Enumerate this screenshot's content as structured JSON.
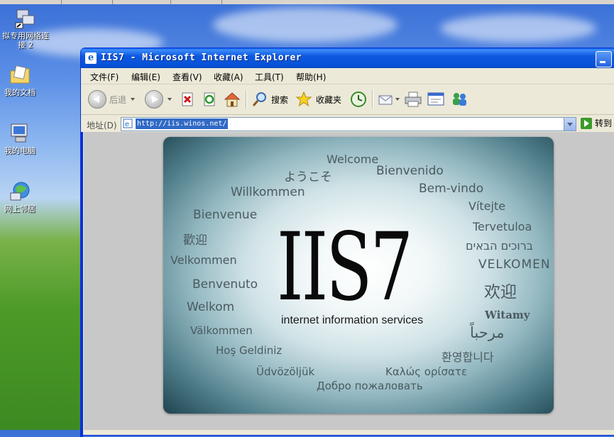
{
  "desktop": {
    "icons": [
      {
        "label": "拟专用网络连接 2",
        "icon": "network-connection-icon"
      },
      {
        "label": "我的文档",
        "icon": "my-documents-icon"
      },
      {
        "label": "我的电脑",
        "icon": "my-computer-icon"
      },
      {
        "label": "网上邻居",
        "icon": "network-places-icon"
      }
    ]
  },
  "window": {
    "title": "IIS7 - Microsoft Internet Explorer",
    "menu": [
      "文件(F)",
      "编辑(E)",
      "查看(V)",
      "收藏(A)",
      "工具(T)",
      "帮助(H)"
    ],
    "toolbar": {
      "back_label": "后退",
      "search_label": "搜索",
      "favorites_label": "收藏夹"
    },
    "address": {
      "label": "地址(D)",
      "url": "http://iis.winos.net/",
      "go_label": "转到"
    }
  },
  "page": {
    "logo_text": "IIS7",
    "subtitle": "internet information services",
    "greetings": [
      "Welcome",
      "ようこそ",
      "Bienvenido",
      "Willkommen",
      "Bem-vindo",
      "Vítejte",
      "Bienvenue",
      "Tervetuloa",
      "歡迎",
      "ברוכים הבאים",
      "Velkommen",
      "VELKOMEN",
      "Benvenuto",
      "欢迎",
      "Welkom",
      "Witamy",
      "Välkommen",
      "مرحباً",
      "Hoş Geldiniz",
      "환영합니다",
      "Üdvözöljük",
      "Καλώς ορίσατε",
      "Добро пожаловать"
    ]
  }
}
